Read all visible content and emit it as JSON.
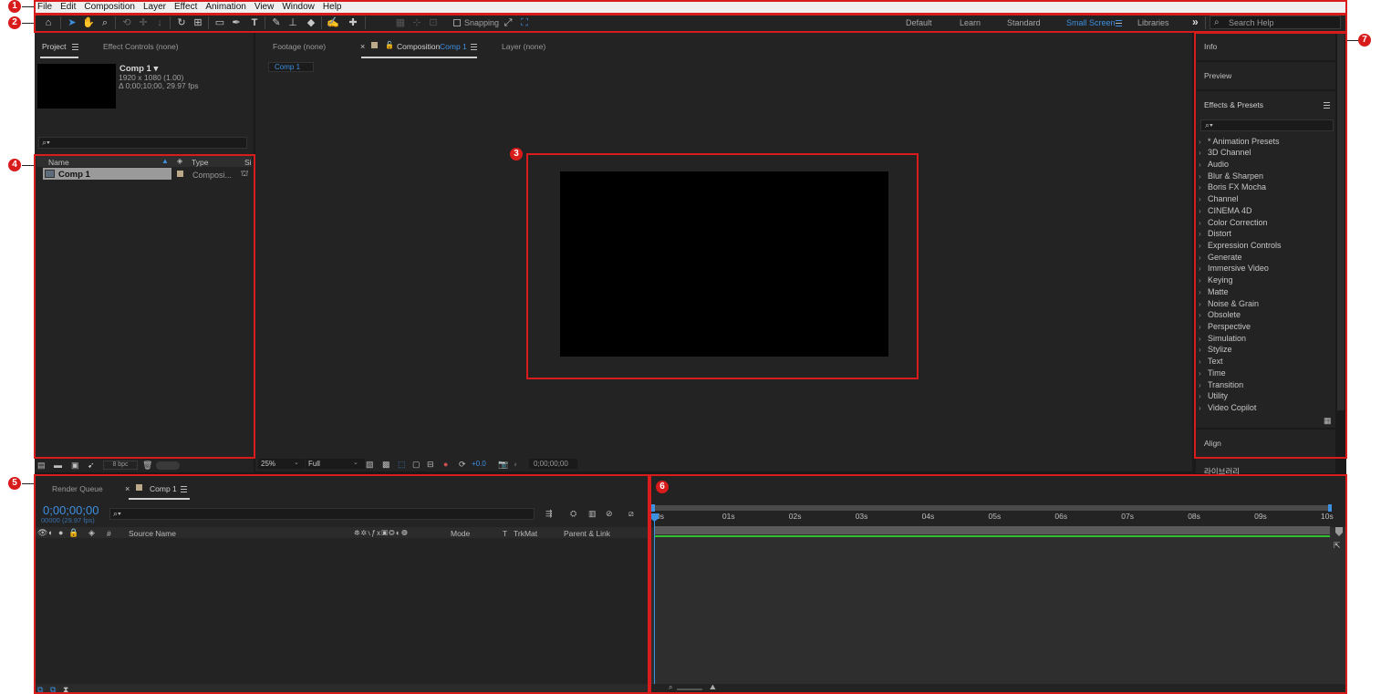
{
  "menu": [
    "File",
    "Edit",
    "Composition",
    "Layer",
    "Effect",
    "Animation",
    "View",
    "Window",
    "Help"
  ],
  "toolbar": {
    "snapping_label": "Snapping",
    "workspaces": [
      {
        "label": "Default",
        "active": false
      },
      {
        "label": "Learn",
        "active": false
      },
      {
        "label": "Standard",
        "active": false
      },
      {
        "label": "Small Screen",
        "active": true
      },
      {
        "label": "Libraries",
        "active": false
      }
    ],
    "overflow_symbol": "»",
    "search_placeholder": "Search Help"
  },
  "project_panel": {
    "tabs": [
      "Project",
      "Effect Controls (none)"
    ],
    "comp_name": "Comp 1 ▾",
    "comp_size": "1920 x 1080 (1.00)",
    "comp_duration": "Δ 0;00;10;00, 29.97 fps",
    "columns": [
      "Name",
      "Type",
      "Si"
    ],
    "items": [
      {
        "name": "Comp 1",
        "type": "Composi..."
      }
    ],
    "bpc_label": "8 bpc"
  },
  "viewer": {
    "tabs": [
      "Footage (none)",
      "Composition",
      "Comp 1",
      "Layer (none)"
    ],
    "breadcrumb": "Comp 1",
    "zoom": "25%",
    "resolution": "Full",
    "exposure": "+0.0",
    "timecode": "0;00;00;00"
  },
  "right_panel": {
    "info_label": "Info",
    "preview_label": "Preview",
    "effects_title": "Effects & Presets",
    "effects": [
      "* Animation Presets",
      "3D Channel",
      "Audio",
      "Blur & Sharpen",
      "Boris FX Mocha",
      "Channel",
      "CINEMA 4D",
      "Color Correction",
      "Distort",
      "Expression Controls",
      "Generate",
      "Immersive Video",
      "Keying",
      "Matte",
      "Noise & Grain",
      "Obsolete",
      "Perspective",
      "Simulation",
      "Stylize",
      "Text",
      "Time",
      "Transition",
      "Utility",
      "Video Copilot"
    ],
    "align_label": "Align",
    "cut_label": "라이브러리"
  },
  "timeline": {
    "tabs": [
      "Render Queue",
      "Comp 1"
    ],
    "timecode": "0;00;00;00",
    "fps": "00000 (29.97 fps)",
    "columns": {
      "number": "#",
      "source": "Source Name",
      "mode": "Mode",
      "t": "T",
      "trkmat": "TrkMat",
      "parent": "Parent & Link"
    },
    "ruler": [
      "0s",
      "01s",
      "02s",
      "03s",
      "04s",
      "05s",
      "06s",
      "07s",
      "08s",
      "09s",
      "10s"
    ]
  },
  "markers": [
    "1",
    "2",
    "3",
    "4",
    "5",
    "6",
    "7"
  ],
  "colors": {
    "accent": "#3d8fe0",
    "annotation": "#d81b1b",
    "work_area": "#30c030",
    "panel": "#232323"
  }
}
